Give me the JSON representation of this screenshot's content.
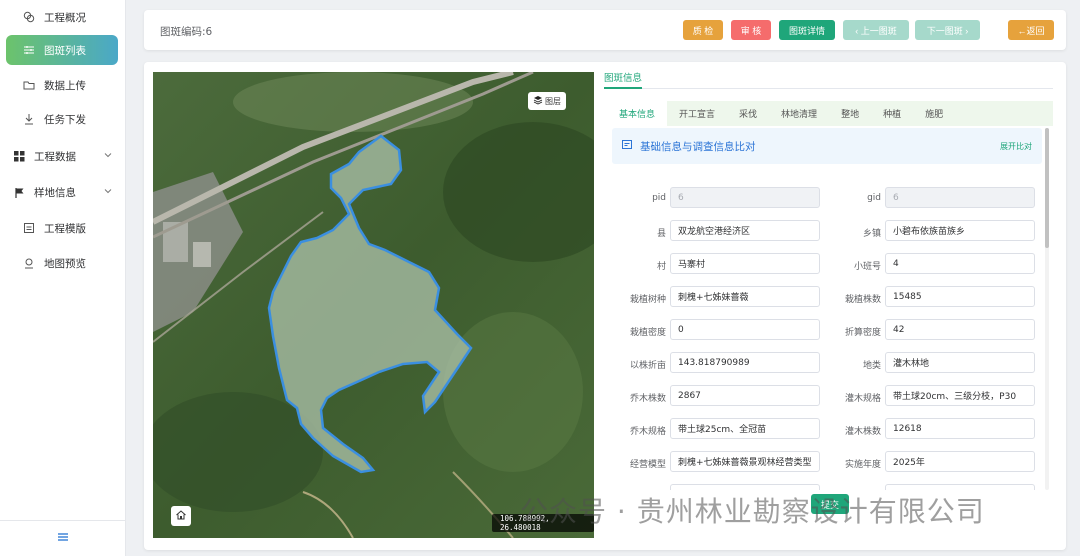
{
  "sidebar": {
    "items": [
      {
        "label": "工程概况",
        "icon": "overview-icon"
      },
      {
        "label": "图斑列表",
        "icon": "list-icon",
        "active": true
      },
      {
        "label": "数据上传",
        "icon": "folder-icon"
      },
      {
        "label": "任务下发",
        "icon": "download-icon"
      },
      {
        "label": "工程数据",
        "icon": "grid-icon",
        "expandable": true
      },
      {
        "label": "样地信息",
        "icon": "flag-icon",
        "expandable": true
      },
      {
        "label": "工程模版",
        "icon": "template-icon"
      },
      {
        "label": "地图预览",
        "icon": "map-pin-icon"
      }
    ],
    "collapse_icon": "menu-icon"
  },
  "topbar": {
    "code_text": "图斑编码:6",
    "buttons": {
      "quality": "质 检",
      "review": "审 核",
      "detail": "图斑详情",
      "prev": "‹ 上一图斑",
      "next": "下一图斑 ›",
      "back": "←返回"
    }
  },
  "map": {
    "layer_button": "图层",
    "coords": "106.788992, 26.480018"
  },
  "panel": {
    "title_tab": "图斑信息",
    "tabs": [
      "基本信息",
      "开工宣言",
      "采伐",
      "林地清理",
      "整地",
      "种植",
      "施肥"
    ],
    "active_tab": "基本信息",
    "section_title": "基础信息与调查信息比对",
    "expand_label": "展开比对",
    "fields": {
      "pid": {
        "label": "pid",
        "value": "6"
      },
      "gid": {
        "label": "gid",
        "value": "6"
      },
      "county": {
        "label": "县",
        "value": "双龙航空港经济区"
      },
      "town": {
        "label": "乡镇",
        "value": "小碧布依族苗族乡"
      },
      "village": {
        "label": "村",
        "value": "马寨村"
      },
      "subplot": {
        "label": "小班号",
        "value": "4"
      },
      "species": {
        "label": "栽植树种",
        "value": "刺槐+七姊妹蔷薇"
      },
      "plant_count": {
        "label": "栽植株数",
        "value": "15485"
      },
      "density": {
        "label": "栽植密度",
        "value": "0"
      },
      "calc_density": {
        "label": "折算密度",
        "value": "42"
      },
      "area_mu": {
        "label": "以株折亩",
        "value": "143.818790989"
      },
      "land_type": {
        "label": "地类",
        "value": "灌木林地"
      },
      "tree_count": {
        "label": "乔木株数",
        "value": "2867"
      },
      "shrub_spec": {
        "label": "灌木规格",
        "value": "带土球20cm、三级分枝，P30"
      },
      "tree_spec": {
        "label": "乔木规格",
        "value": "带土球25cm、全冠苗"
      },
      "shrub_count": {
        "label": "灌木株数",
        "value": "12618"
      },
      "model": {
        "label": "经营模型",
        "value": "刺槐+七姊妹蔷薇景观林经营类型"
      },
      "year": {
        "label": "实施年度",
        "value": "2025年"
      }
    },
    "submit_label": "提交"
  },
  "watermark": "公众号 · 贵州林业勘察设计有限公司",
  "colors": {
    "accent": "#1fa67a",
    "orange": "#e6a23c",
    "red": "#f56c6c",
    "polygon_stroke": "#3b8fe0"
  }
}
